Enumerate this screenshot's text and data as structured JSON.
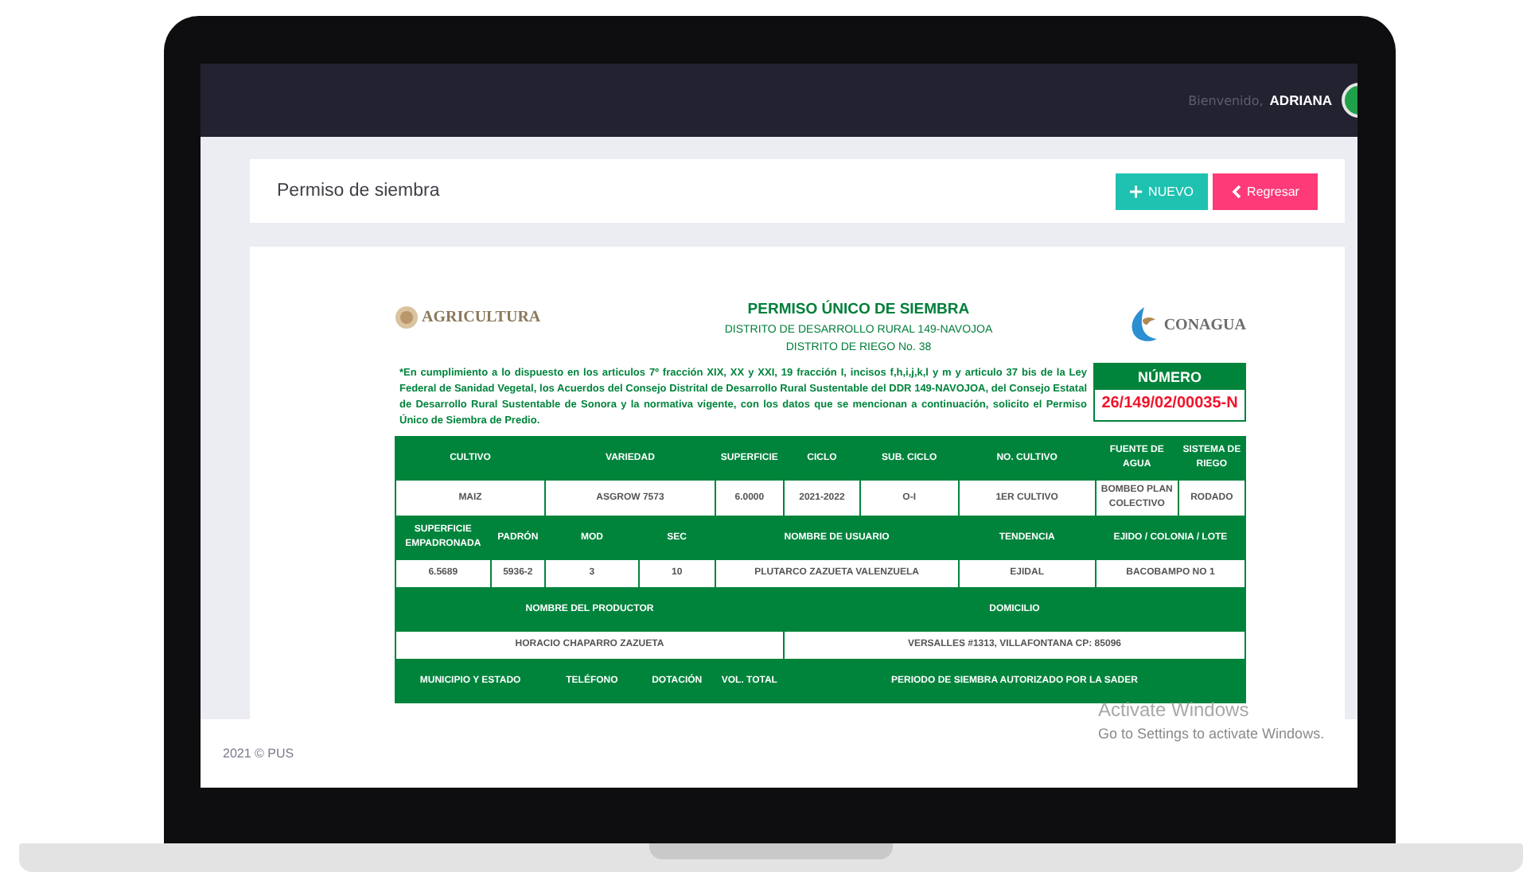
{
  "topbar": {
    "greeting": "Bienvenido,",
    "user": "ADRIANA"
  },
  "page_header": {
    "title": "Permiso de siembra",
    "buttons": [
      {
        "kind": "new",
        "label": "NUEVO"
      },
      {
        "kind": "back",
        "label": "Regresar"
      }
    ]
  },
  "document": {
    "left_logo": "AGRICULTURA",
    "right_logo": "CONAGUA",
    "title": "PERMISO ÚNICO DE SIEMBRA",
    "subtitles": [
      "DISTRITO DE DESARROLLO RURAL 149-NAVOJOA",
      "DISTRITO DE RIEGO No. 38"
    ],
    "statement": "*En cumplimiento a lo dispuesto en los articulos 7º fracción XIX, XX y XXI, 19 fracción I, incisos f,h,i,j,k,l y m y articulo 37 bis de la Ley Federal de Sanidad Vegetal, los Acuerdos del Consejo Distrital de Desarrollo Rural Sustentable del DDR 149-NAVOJOA, del Consejo Estatal de Desarrollo Rural Sustentable de Sonora y la normativa vigente, con los datos que se mencionan a continuación, solicito el Permiso Único de Siembra de Predio.",
    "number_label": "NÚMERO",
    "number": "26/149/02/00035-N",
    "table": [
      {
        "kind": "header",
        "cells": [
          "CULTIVO",
          "VARIEDAD",
          "SUPERFICIE",
          "CICLO",
          "SUB. CICLO",
          "NO. CULTIVO",
          "FUENTE DE AGUA",
          "SISTEMA DE RIEGO"
        ]
      },
      {
        "kind": "data",
        "cells": [
          "MAIZ",
          "ASGROW 7573",
          "6.0000",
          "2021-2022",
          "O-I",
          "1ER CULTIVO",
          "BOMBEO PLAN COLECTIVO",
          "RODADO"
        ]
      },
      {
        "kind": "header",
        "cells": [
          "SUPERFICIE EMPADRONADA",
          "PADRÓN",
          "MOD",
          "SEC",
          "NOMBRE DE USUARIO",
          "TENDENCIA",
          "EJIDO / COLONIA / LOTE"
        ]
      },
      {
        "kind": "data",
        "cells": [
          "6.5689",
          "5936-2",
          "3",
          "10",
          "PLUTARCO ZAZUETA VALENZUELA",
          "EJIDAL",
          "BACOBAMPO NO 1"
        ]
      },
      {
        "kind": "header",
        "cells": [
          "NOMBRE DEL PRODUCTOR",
          "DOMICILIO"
        ]
      },
      {
        "kind": "data",
        "cells": [
          "HORACIO CHAPARRO ZAZUETA",
          "VERSALLES #1313, VILLAFONTANA CP: 85096"
        ]
      },
      {
        "kind": "header",
        "cells": [
          "MUNICIPIO Y ESTADO",
          "TELÉFONO",
          "DOTACIÓN",
          "VOL. TOTAL",
          "PERIODO DE SIEMBRA AUTORIZADO POR LA SADER"
        ]
      }
    ]
  },
  "footer": "2021 © PUS",
  "os_notice": {
    "title": "Activate Windows",
    "text": "Go to Settings to activate Windows."
  }
}
